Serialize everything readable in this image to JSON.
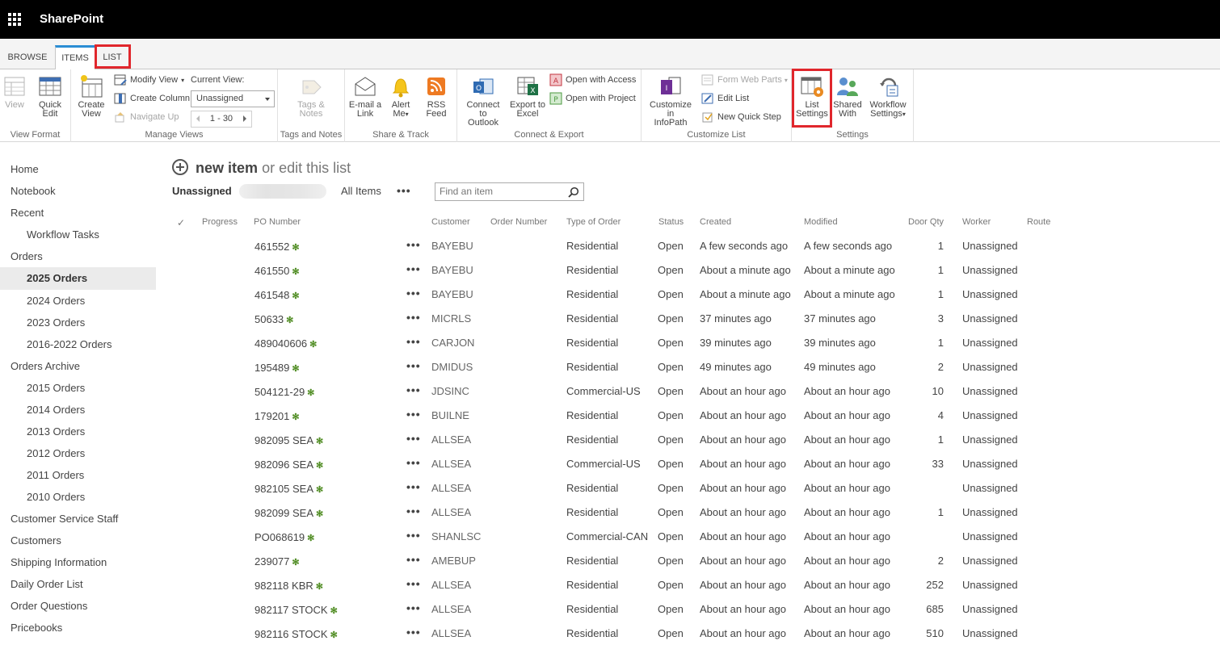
{
  "suitebar": {
    "brand": "SharePoint",
    "waffle_icon": "app-launcher-icon"
  },
  "ribbon_tabs": {
    "browse": "BROWSE",
    "items": "ITEMS",
    "list": "LIST"
  },
  "ribbon": {
    "view_format": {
      "label": "View Format",
      "view": "View",
      "quick_edit_1": "Quick",
      "quick_edit_2": "Edit"
    },
    "manage_views": {
      "label": "Manage Views",
      "create_view_1": "Create",
      "create_view_2": "View",
      "modify_view": "Modify View",
      "create_column": "Create Column",
      "navigate_up": "Navigate Up",
      "current_view_label": "Current View:",
      "current_view_value": "Unassigned",
      "pager": "1 - 30"
    },
    "tags_notes": {
      "label": "Tags and Notes",
      "btn_1": "Tags &",
      "btn_2": "Notes"
    },
    "share_track": {
      "label": "Share & Track",
      "email_1": "E-mail a",
      "email_2": "Link",
      "alert_1": "Alert",
      "alert_2": "Me",
      "rss_1": "RSS",
      "rss_2": "Feed"
    },
    "connect_export": {
      "label": "Connect & Export",
      "outlook_1": "Connect to",
      "outlook_2": "Outlook",
      "excel_1": "Export to",
      "excel_2": "Excel",
      "open_access": "Open with Access",
      "open_project": "Open with Project"
    },
    "customize_list": {
      "label": "Customize List",
      "infopath_1": "Customize in",
      "infopath_2": "InfoPath",
      "form_web_parts": "Form Web Parts",
      "edit_list": "Edit List",
      "new_quick_step": "New Quick Step"
    },
    "settings": {
      "label": "Settings",
      "list_settings_1": "List",
      "list_settings_2": "Settings",
      "shared_with_1": "Shared",
      "shared_with_2": "With",
      "workflow_1": "Workflow",
      "workflow_2": "Settings"
    }
  },
  "leftnav": [
    {
      "label": "Home",
      "level": 0
    },
    {
      "label": "Notebook",
      "level": 0
    },
    {
      "label": "Recent",
      "level": 0
    },
    {
      "label": "Workflow Tasks",
      "level": 1
    },
    {
      "label": "Orders",
      "level": 0
    },
    {
      "label": "2025 Orders",
      "level": 1,
      "selected": true
    },
    {
      "label": "2024 Orders",
      "level": 1
    },
    {
      "label": "2023 Orders",
      "level": 1
    },
    {
      "label": "2016-2022 Orders",
      "level": 1
    },
    {
      "label": "Orders Archive",
      "level": 0
    },
    {
      "label": "2015 Orders",
      "level": 1
    },
    {
      "label": "2014 Orders",
      "level": 1
    },
    {
      "label": "2013 Orders",
      "level": 1
    },
    {
      "label": "2012 Orders",
      "level": 1
    },
    {
      "label": "2011 Orders",
      "level": 1
    },
    {
      "label": "2010 Orders",
      "level": 1
    },
    {
      "label": "Customer Service Staff",
      "level": 0
    },
    {
      "label": "Customers",
      "level": 0
    },
    {
      "label": "Shipping Information",
      "level": 0
    },
    {
      "label": "Daily Order List",
      "level": 0
    },
    {
      "label": "Order Questions",
      "level": 0
    },
    {
      "label": "Pricebooks",
      "level": 0
    }
  ],
  "main": {
    "new_item": "new item",
    "or_edit": "or edit this list",
    "view_current": "Unassigned",
    "view_all": "All Items",
    "more_views": "•••",
    "search_placeholder": "Find an item",
    "check_glyph": "✓",
    "new_glyph": "✻"
  },
  "columns": [
    "Progress",
    "PO Number",
    "Customer",
    "Order Number",
    "Type of Order",
    "Status",
    "Created",
    "Modified",
    "Door Qty",
    "Worker",
    "Route"
  ],
  "rows": [
    {
      "po": "461552",
      "customer": "BAYEBU",
      "type": "Residential",
      "status": "Open",
      "created": "A few seconds ago",
      "modified": "A few seconds ago",
      "qty": "1",
      "worker": "Unassigned"
    },
    {
      "po": "461550",
      "customer": "BAYEBU",
      "type": "Residential",
      "status": "Open",
      "created": "About a minute ago",
      "modified": "About a minute ago",
      "qty": "1",
      "worker": "Unassigned"
    },
    {
      "po": "461548",
      "customer": "BAYEBU",
      "type": "Residential",
      "status": "Open",
      "created": "About a minute ago",
      "modified": "About a minute ago",
      "qty": "1",
      "worker": "Unassigned"
    },
    {
      "po": "50633",
      "customer": "MICRLS",
      "type": "Residential",
      "status": "Open",
      "created": "37 minutes ago",
      "modified": "37 minutes ago",
      "qty": "3",
      "worker": "Unassigned"
    },
    {
      "po": "489040606",
      "customer": "CARJON",
      "type": "Residential",
      "status": "Open",
      "created": "39 minutes ago",
      "modified": "39 minutes ago",
      "qty": "1",
      "worker": "Unassigned"
    },
    {
      "po": "195489",
      "customer": "DMIDUS",
      "type": "Residential",
      "status": "Open",
      "created": "49 minutes ago",
      "modified": "49 minutes ago",
      "qty": "2",
      "worker": "Unassigned"
    },
    {
      "po": "504121-29",
      "customer": "JDSINC",
      "type": "Commercial-US",
      "status": "Open",
      "created": "About an hour ago",
      "modified": "About an hour ago",
      "qty": "10",
      "worker": "Unassigned"
    },
    {
      "po": "179201",
      "customer": "BUILNE",
      "type": "Residential",
      "status": "Open",
      "created": "About an hour ago",
      "modified": "About an hour ago",
      "qty": "4",
      "worker": "Unassigned"
    },
    {
      "po": "982095 SEA",
      "customer": "ALLSEA",
      "type": "Residential",
      "status": "Open",
      "created": "About an hour ago",
      "modified": "About an hour ago",
      "qty": "1",
      "worker": "Unassigned"
    },
    {
      "po": "982096 SEA",
      "customer": "ALLSEA",
      "type": "Commercial-US",
      "status": "Open",
      "created": "About an hour ago",
      "modified": "About an hour ago",
      "qty": "33",
      "worker": "Unassigned"
    },
    {
      "po": "982105 SEA",
      "customer": "ALLSEA",
      "type": "Residential",
      "status": "Open",
      "created": "About an hour ago",
      "modified": "About an hour ago",
      "qty": "",
      "worker": "Unassigned"
    },
    {
      "po": "982099 SEA",
      "customer": "ALLSEA",
      "type": "Residential",
      "status": "Open",
      "created": "About an hour ago",
      "modified": "About an hour ago",
      "qty": "1",
      "worker": "Unassigned"
    },
    {
      "po": "PO068619",
      "customer": "SHANLSC",
      "type": "Commercial-CAN",
      "status": "Open",
      "created": "About an hour ago",
      "modified": "About an hour ago",
      "qty": "",
      "worker": "Unassigned"
    },
    {
      "po": "239077",
      "customer": "AMEBUP",
      "type": "Residential",
      "status": "Open",
      "created": "About an hour ago",
      "modified": "About an hour ago",
      "qty": "2",
      "worker": "Unassigned"
    },
    {
      "po": "982118 KBR",
      "customer": "ALLSEA",
      "type": "Residential",
      "status": "Open",
      "created": "About an hour ago",
      "modified": "About an hour ago",
      "qty": "252",
      "worker": "Unassigned"
    },
    {
      "po": "982117 STOCK",
      "customer": "ALLSEA",
      "type": "Residential",
      "status": "Open",
      "created": "About an hour ago",
      "modified": "About an hour ago",
      "qty": "685",
      "worker": "Unassigned"
    },
    {
      "po": "982116 STOCK",
      "customer": "ALLSEA",
      "type": "Residential",
      "status": "Open",
      "created": "About an hour ago",
      "modified": "About an hour ago",
      "qty": "510",
      "worker": "Unassigned"
    }
  ],
  "colors": {
    "suitebar": "#000000",
    "accent": "#2a8dd4",
    "highlight_box": "#e0262c",
    "new_marker": "#4f8c22"
  }
}
